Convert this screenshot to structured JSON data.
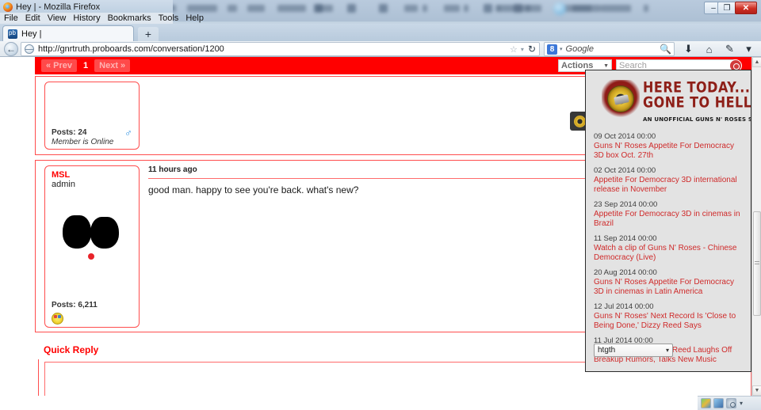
{
  "browser": {
    "window_title": "Hey | - Mozilla Firefox",
    "menu_items": [
      "File",
      "Edit",
      "View",
      "History",
      "Bookmarks",
      "Tools",
      "Help"
    ],
    "tab_title": "Hey |",
    "newtab_label": "+",
    "url": "http://gnrtruth.proboards.com/conversation/1200",
    "search_engine": "Google",
    "search_badge": "8",
    "back_glyph": "←",
    "reload_glyph": "↻",
    "star_glyph": "☆",
    "dropdown_glyph": "▾",
    "download_glyph": "⬇",
    "home_glyph": "⌂",
    "bookmarks_glyph": "✎",
    "overflow_glyph": "▾",
    "minimize_glyph": "–",
    "maximize_glyph": "❐",
    "close_glyph": "✕"
  },
  "forum": {
    "pager": {
      "prev_label": "« Prev",
      "current_page": "1",
      "next_label": "Next »"
    },
    "actions_label": "Actions",
    "actions_caret": "▼",
    "search_placeholder": "Search",
    "accent_color": "#ff0000",
    "posts": [
      {
        "author": "",
        "rank": "",
        "posts_label": "Posts: 24",
        "status": "Member is Online",
        "gender_glyph": "♂",
        "time": "",
        "message": ""
      },
      {
        "author": "MSL",
        "rank": "admin",
        "posts_label": "Posts: 6,211",
        "status": "",
        "time": "11 hours ago",
        "message": "good man. happy to see you're back. what's new?"
      }
    ],
    "quick_reply_title": "Quick Reply"
  },
  "news_panel": {
    "logo": {
      "line1": "HERE TODAY...",
      "line2": "GONE TO HELL!",
      "tagline": "AN UNOFFICIAL GUNS N' ROSES SITE"
    },
    "items": [
      {
        "date": "09 Oct 2014 00:00",
        "title": "Guns N' Roses Appetite For Democracy 3D box Oct. 27th"
      },
      {
        "date": "02 Oct 2014 00:00",
        "title": "Appetite For Democracy 3D international release in November"
      },
      {
        "date": "23 Sep 2014 00:00",
        "title": "Appetite For Democracy 3D in cinemas in Brazil"
      },
      {
        "date": "11 Sep 2014 00:00",
        "title": "Watch a clip of Guns N' Roses - Chinese Democracy (Live)"
      },
      {
        "date": "20 Aug 2014 00:00",
        "title": "Guns N' Roses Appetite For Democracy 3D in cinemas in Latin America"
      },
      {
        "date": "12 Jul 2014 00:00",
        "title": "Guns N' Roses' Next Record Is 'Close to Being Done,' Dizzy Reed Says"
      },
      {
        "date": "11 Jul 2014 00:00",
        "title": "Guns N' Roses' Dizzy Reed Laughs Off Breakup Rumors, Talks New Music"
      }
    ],
    "select_value": "htgth",
    "select_caret": "▾"
  },
  "scrollbar": {
    "up_glyph": "▲",
    "down_glyph": "▼"
  },
  "tray": {
    "caret": "▾"
  }
}
